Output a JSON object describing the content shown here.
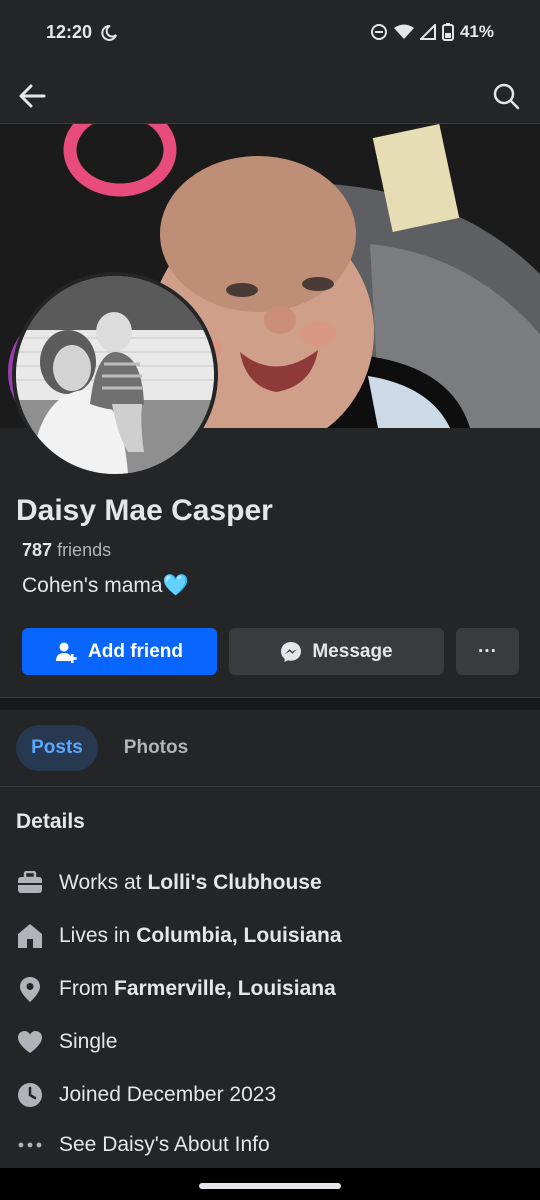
{
  "status_bar": {
    "time": "12:20",
    "battery": "41%"
  },
  "profile": {
    "name": "Daisy Mae Casper",
    "friends_count": "787",
    "friends_label": "friends",
    "bio_text": "Cohen's mama",
    "bio_emoji": "🩵"
  },
  "actions": {
    "add_friend": "Add friend",
    "message": "Message",
    "more": "···"
  },
  "tabs": [
    {
      "label": "Posts",
      "active": true
    },
    {
      "label": "Photos",
      "active": false
    }
  ],
  "details": {
    "title": "Details",
    "work_prefix": "Works at",
    "work_value": "Lolli's Clubhouse",
    "lives_prefix": "Lives in",
    "lives_value": "Columbia, Louisiana",
    "from_prefix": "From",
    "from_value": "Farmerville, Louisiana",
    "relationship": "Single",
    "joined": "Joined December 2023",
    "about_link": "See Daisy's About Info"
  },
  "colors": {
    "background": "#242526",
    "primary_button": "#0866ff",
    "secondary_button": "#3a3b3c",
    "active_tab_text": "#5aa7ff"
  },
  "icons": {
    "back": "arrow-left-icon",
    "search": "search-icon",
    "add_friend": "add-person-icon",
    "message": "messenger-icon",
    "work": "briefcase-icon",
    "home": "house-icon",
    "from": "location-pin-icon",
    "relationship": "heart-icon",
    "joined": "clock-icon",
    "about": "dots-icon"
  }
}
